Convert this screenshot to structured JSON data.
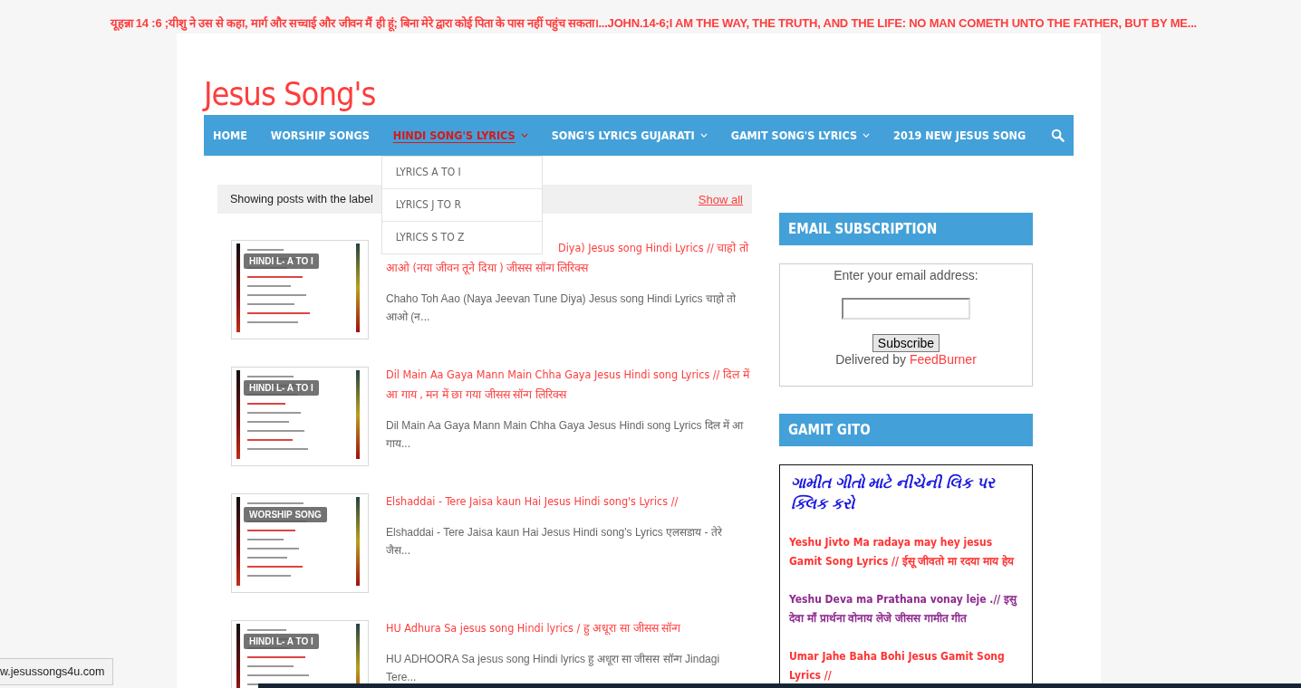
{
  "ticker": "यूहन्ना 14 :6 ;यीशु ने उस से कहा, मार्ग और सच्चाई और जीवन मैं ही हूं; बिना मेरे द्वारा कोई पिता के पास नहीं पहुंच सकता।...JOHN.14-6;I AM THE WAY, THE TRUTH, AND THE LIFE: NO MAN COMETH UNTO THE FATHER, BUT BY ME...",
  "site_title": "Jesus Song's",
  "nav": [
    {
      "label": "HOME",
      "selected": false,
      "has_menu": false
    },
    {
      "label": "WORSHIP SONGS",
      "selected": false,
      "has_menu": false
    },
    {
      "label": "HINDI SONG'S LYRICS",
      "selected": true,
      "has_menu": true,
      "expanded": true,
      "submenu": [
        "LYRICS A TO I",
        "LYRICS J TO R",
        "LYRICS S TO Z"
      ]
    },
    {
      "label": "SONG'S LYRICS GUJARATI",
      "selected": false,
      "has_menu": true
    },
    {
      "label": "GAMIT SONG'S LYRICS",
      "selected": false,
      "has_menu": true
    },
    {
      "label": "2019 NEW JESUS SONG",
      "selected": false,
      "has_menu": false
    }
  ],
  "label_bar": {
    "text": "Showing posts with the label",
    "link": "Show all"
  },
  "posts": [
    {
      "badge": "HINDI L- A TO I",
      "title_lines": [
        "Diya) Jesus song Hindi Lyrics // चाहो तो",
        "आओ (नया जीवन तूने दिया ) जीसस सॉन्ग लिरिक्स"
      ],
      "title_partly_hidden": true,
      "excerpt": "Chaho Toh Aao (Naya Jeevan Tune Diya)  Jesus song Hindi Lyrics चाहो तो आओ (न..."
    },
    {
      "badge": "HINDI L- A TO I",
      "title_lines": [
        "Dil Main Aa Gaya Mann Main Chha Gaya Jesus Hindi song Lyrics // दिल में",
        "आ गाय , मन में छा गया जीसस सॉन्ग लिरिक्स"
      ],
      "title_partly_hidden": false,
      "excerpt": "Dil Main Aa Gaya Mann Main Chha Gaya  Jesus Hindi song Lyrics दिल में आ गाय..."
    },
    {
      "badge": "WORSHIP SONG",
      "title_lines": [
        "Elshaddai - Tere Jaisa kaun Hai Jesus Hindi song's Lyrics //"
      ],
      "title_partly_hidden": false,
      "excerpt": "Elshaddai - Tere Jaisa kaun Hai Jesus Hindi song's Lyrics एलसडाय  - तेरे जैस..."
    },
    {
      "badge": "HINDI L- A TO I",
      "title_lines": [
        "HU Adhura Sa jesus song Hindi lyrics / हु अधूरा सा जीसस सॉन्ग"
      ],
      "title_partly_hidden": false,
      "excerpt": "HU ADHOORA Sa jesus song Hindi lyrics   हु अधूरा सा जीसस सॉन्ग Jindagi Tere..."
    }
  ],
  "sidebar": {
    "email": {
      "heading": "EMAIL SUBSCRIPTION",
      "prompt": "Enter your email address:",
      "button": "Subscribe",
      "delivered_by": "Delivered by",
      "provider": "FeedBurner"
    },
    "gamit": {
      "heading": "GAMIT GITO",
      "intro": "ગામીત ગીતો માટે નીચેની લિક પર ક્લિક કરો",
      "links": [
        {
          "text": "Yeshu Jivto Ma radaya may hey jesus Gamit Song Lyrics // ईसू जीवतो मा रदया माय हेय",
          "color": "#ff3333"
        },
        {
          "text": "Yeshu Deva ma Prathana vonay leje .// इसु देवा माँ प्रार्थना वोनाय लेजे जीसस गामीत गीत",
          "color": "#8e2a8e"
        },
        {
          "text": "Umar Jahe Baha Bohi Jesus Gamit Song Lyrics //",
          "color": "#ff3333"
        }
      ]
    }
  },
  "status_url": "w.jesussongs4u.com"
}
